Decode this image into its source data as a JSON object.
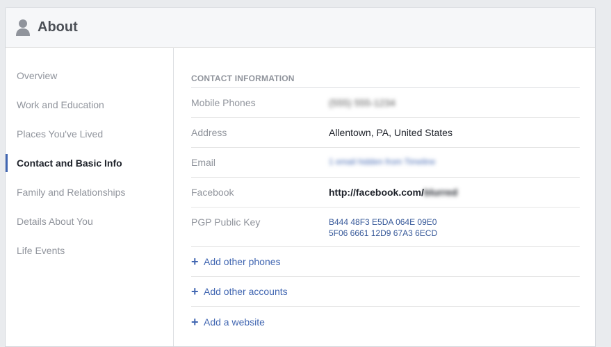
{
  "header": {
    "title": "About",
    "icon": "person-silhouette-icon"
  },
  "sidebar": {
    "items": [
      {
        "label": "Overview",
        "active": false
      },
      {
        "label": "Work and Education",
        "active": false
      },
      {
        "label": "Places You've Lived",
        "active": false
      },
      {
        "label": "Contact and Basic Info",
        "active": true
      },
      {
        "label": "Family and Relationships",
        "active": false
      },
      {
        "label": "Details About You",
        "active": false
      },
      {
        "label": "Life Events",
        "active": false
      }
    ]
  },
  "contact": {
    "section_title": "CONTACT INFORMATION",
    "mobile_label": "Mobile Phones",
    "mobile_value": "(555) 555-1234",
    "address_label": "Address",
    "address_value": "Allentown, PA, United States",
    "email_label": "Email",
    "email_value": "1 email hidden from Timeline",
    "facebook_label": "Facebook",
    "facebook_prefix": "http://facebook.com/",
    "facebook_user": "blurred",
    "pgp_label": "PGP Public Key",
    "pgp_line1": "B444 48F3 E5DA 064E 09E0",
    "pgp_line2": "5F06 6661 12D9 67A3 6ECD",
    "add_phones": "Add other phones",
    "add_accounts": "Add other accounts",
    "add_website": "Add a website",
    "plus_icon": "+"
  },
  "colors": {
    "accent": "#4267b2",
    "link": "#365899",
    "muted": "#90949c",
    "text": "#1d2129"
  }
}
